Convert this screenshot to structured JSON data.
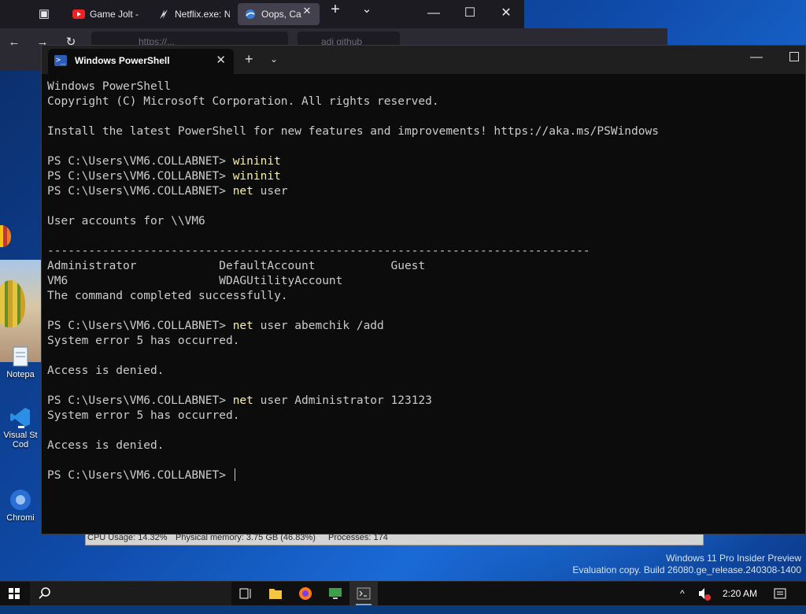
{
  "browser": {
    "tabs": [
      {
        "label": "Game Jolt -",
        "icon": "youtube-icon",
        "active": false
      },
      {
        "label": "Netflix.exe: N",
        "icon": "netflix-icon",
        "active": false
      },
      {
        "label": "Oops, Ca",
        "icon": "browser-tab-icon",
        "active": true
      }
    ],
    "new_tab": "+",
    "list_tabs": "⌄",
    "minimize": "—",
    "maximize": "☐",
    "close": "✕",
    "url_text": "https://...",
    "search_text": "adi github"
  },
  "terminal": {
    "tab_title": "Windows PowerShell",
    "tab_close": "✕",
    "new_tab": "+",
    "dropdown": "⌄",
    "minimize": "—",
    "lines": [
      {
        "text": "Windows PowerShell"
      },
      {
        "text": "Copyright (C) Microsoft Corporation. All rights reserved."
      },
      {
        "text": ""
      },
      {
        "text": "Install the latest PowerShell for new features and improvements! https://aka.ms/PSWindows"
      },
      {
        "text": ""
      },
      {
        "prompt": "PS C:\\Users\\VM6.COLLABNET> ",
        "cmd": "wininit",
        "args": ""
      },
      {
        "prompt": "PS C:\\Users\\VM6.COLLABNET> ",
        "cmd": "wininit",
        "args": ""
      },
      {
        "prompt": "PS C:\\Users\\VM6.COLLABNET> ",
        "cmd": "net",
        "args": " user"
      },
      {
        "text": ""
      },
      {
        "text": "User accounts for \\\\VM6"
      },
      {
        "text": ""
      },
      {
        "text": "-------------------------------------------------------------------------------"
      },
      {
        "text": "Administrator            DefaultAccount           Guest"
      },
      {
        "text": "VM6                      WDAGUtilityAccount"
      },
      {
        "text": "The command completed successfully."
      },
      {
        "text": ""
      },
      {
        "prompt": "PS C:\\Users\\VM6.COLLABNET> ",
        "cmd": "net",
        "args": " user abemchik /add"
      },
      {
        "text": "System error 5 has occurred."
      },
      {
        "text": ""
      },
      {
        "text": "Access is denied."
      },
      {
        "text": ""
      },
      {
        "prompt": "PS C:\\Users\\VM6.COLLABNET> ",
        "cmd": "net",
        "args": " user Administrator 123123"
      },
      {
        "text": "System error 5 has occurred."
      },
      {
        "text": ""
      },
      {
        "text": "Access is denied."
      },
      {
        "text": ""
      },
      {
        "prompt": "PS C:\\Users\\VM6.COLLABNET> ",
        "cmd": "",
        "args": "",
        "cursor": true
      }
    ]
  },
  "desktop": {
    "icons": [
      {
        "label": "Notepa",
        "icon": "notepad-icon"
      },
      {
        "label": "Visual St\nCod",
        "icon": "vscode-icon"
      },
      {
        "label": "Chromi",
        "icon": "chromium-icon"
      }
    ],
    "watermark": {
      "line1": "Windows 11 Pro Insider Preview",
      "line2": "Evaluation copy. Build 26080.ge_release.240308-1400"
    }
  },
  "taskmgr_strip": {
    "cpu": "CPU Usage: 14.32%",
    "memory": "Physical memory: 3.75 GB (46.83%)",
    "processes": "Processes: 174"
  },
  "taskbar": {
    "items": [
      {
        "name": "start",
        "icon": "windows-start-icon"
      },
      {
        "name": "search",
        "icon": "search-icon"
      },
      {
        "name": "task-view",
        "icon": "task-view-icon"
      },
      {
        "name": "file-explorer",
        "icon": "folder-icon"
      },
      {
        "name": "firefox",
        "icon": "firefox-icon"
      },
      {
        "name": "remote",
        "icon": "remote-desktop-icon"
      },
      {
        "name": "terminal",
        "icon": "terminal-icon",
        "active": true
      }
    ],
    "tray": {
      "chevron": "^",
      "clock": "2:20 AM"
    }
  },
  "colors": {
    "console_bg": "#0c0c0c",
    "console_text": "#cccccc",
    "command_text": "#f9f1a5",
    "titlebar_bg": "#1f1f1f",
    "taskbar_bg": "#101010"
  }
}
